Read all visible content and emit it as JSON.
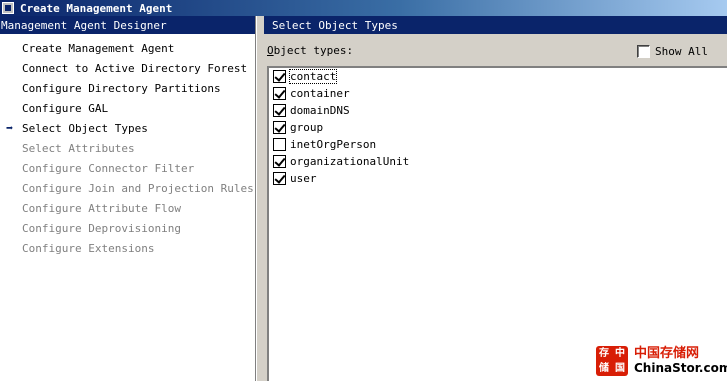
{
  "window": {
    "title": "Create Management Agent"
  },
  "left": {
    "header": "Management Agent Designer",
    "items": [
      {
        "label": "Create Management Agent",
        "enabled": true,
        "current": false
      },
      {
        "label": "Connect to Active Directory Forest",
        "enabled": true,
        "current": false
      },
      {
        "label": "Configure Directory Partitions",
        "enabled": true,
        "current": false
      },
      {
        "label": "Configure GAL",
        "enabled": true,
        "current": false
      },
      {
        "label": "Select Object Types",
        "enabled": true,
        "current": true
      },
      {
        "label": "Select Attributes",
        "enabled": false,
        "current": false
      },
      {
        "label": "Configure Connector Filter",
        "enabled": false,
        "current": false
      },
      {
        "label": "Configure Join and Projection Rules",
        "enabled": false,
        "current": false
      },
      {
        "label": "Configure Attribute Flow",
        "enabled": false,
        "current": false
      },
      {
        "label": "Configure Deprovisioning",
        "enabled": false,
        "current": false
      },
      {
        "label": "Configure Extensions",
        "enabled": false,
        "current": false
      }
    ]
  },
  "right": {
    "header": "Select Object Types",
    "object_types_label": "Object types:",
    "show_all": {
      "label": "Show All",
      "checked": false
    },
    "object_types": [
      {
        "name": "contact",
        "checked": true,
        "focused": true
      },
      {
        "name": "container",
        "checked": true,
        "focused": false
      },
      {
        "name": "domainDNS",
        "checked": true,
        "focused": false
      },
      {
        "name": "group",
        "checked": true,
        "focused": false
      },
      {
        "name": "inetOrgPerson",
        "checked": false,
        "focused": false
      },
      {
        "name": "organizationalUnit",
        "checked": true,
        "focused": false
      },
      {
        "name": "user",
        "checked": true,
        "focused": false
      }
    ]
  },
  "watermark": {
    "logo_text": "存中储国",
    "cn": "中国存储网",
    "en": "ChinaStor.com"
  },
  "colors": {
    "selection_blue": "#0a246a",
    "window_bg": "#d4d0c8",
    "disabled_text": "#808080"
  }
}
